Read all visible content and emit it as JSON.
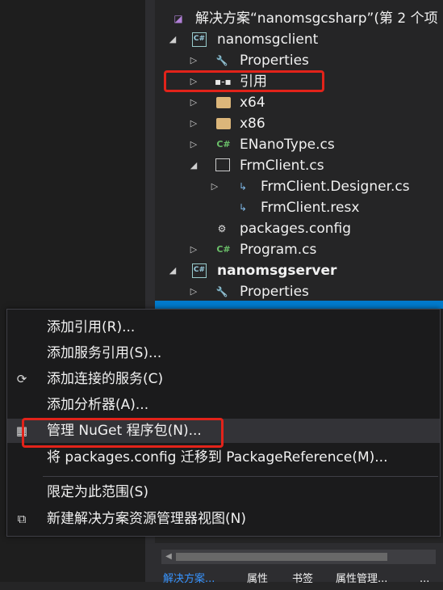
{
  "solution": {
    "title": "解决方案“nanomsgcsharp”(第 2 个项"
  },
  "tree": {
    "client_project": "nanomsgclient",
    "client_items": {
      "properties": "Properties",
      "references": "引用",
      "x64": "x64",
      "x86": "x86",
      "enanotype": "ENanoType.cs",
      "frmclient": "FrmClient.cs",
      "frmclient_designer": "FrmClient.Designer.cs",
      "frmclient_resx": "FrmClient.resx",
      "packages_config": "packages.config",
      "program": "Program.cs"
    },
    "server_project": "nanomsgserver",
    "server_items": {
      "properties": "Properties"
    }
  },
  "context_menu": {
    "items": [
      "添加引用(R)...",
      "添加服务引用(S)...",
      "添加连接的服务(C)",
      "添加分析器(A)...",
      "管理 NuGet 程序包(N)...",
      "将 packages.config 迁移到 PackageReference(M)...",
      "限定为此范围(S)",
      "新建解决方案资源管理器视图(N)"
    ]
  },
  "bottom_tabs": [
    "解决方案...",
    "属性",
    "书签",
    "属性管理...",
    "..."
  ],
  "colors": {
    "highlight": "#e2231a",
    "selection": "#007acc",
    "active_tab": "#3794ff"
  }
}
